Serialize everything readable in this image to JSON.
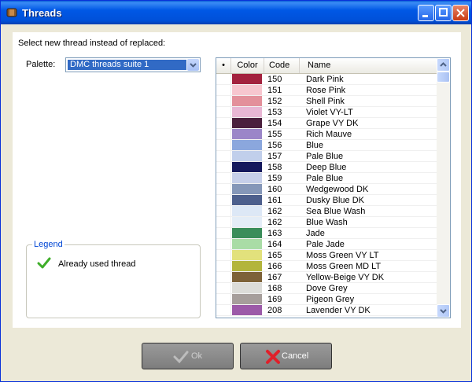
{
  "window": {
    "title": "Threads"
  },
  "prompt": "Select new thread instead of replaced:",
  "palette": {
    "label": "Palette:",
    "value": "DMC threads suite 1"
  },
  "legend": {
    "title": "Legend",
    "items": [
      {
        "label": "Already used thread",
        "icon": "check-icon"
      }
    ]
  },
  "grid": {
    "columns": [
      "•",
      "Color",
      "Code",
      "Name"
    ],
    "rows": [
      {
        "code": "150",
        "name": "Dark Pink",
        "color": "#a3223e"
      },
      {
        "code": "151",
        "name": "Rose Pink",
        "color": "#f7c6cf"
      },
      {
        "code": "152",
        "name": "Shell Pink",
        "color": "#e3909b"
      },
      {
        "code": "153",
        "name": "Violet VY-LT",
        "color": "#e8b6d4"
      },
      {
        "code": "154",
        "name": "Grape VY DK",
        "color": "#4a1f3d"
      },
      {
        "code": "155",
        "name": "Rich Mauve",
        "color": "#9b86c8"
      },
      {
        "code": "156",
        "name": "Blue",
        "color": "#8ba7dd"
      },
      {
        "code": "157",
        "name": "Pale Blue",
        "color": "#c1cfeb"
      },
      {
        "code": "158",
        "name": "Deep Blue",
        "color": "#14185c"
      },
      {
        "code": "159",
        "name": "Pale Blue",
        "color": "#c6cfe9"
      },
      {
        "code": "160",
        "name": "Wedgewood DK",
        "color": "#8597b8"
      },
      {
        "code": "161",
        "name": "Dusky Blue DK",
        "color": "#4d5f8c"
      },
      {
        "code": "162",
        "name": "Sea Blue Wash",
        "color": "#dde8f6"
      },
      {
        "code": "162",
        "name": "Blue Wash",
        "color": "#e4edf7"
      },
      {
        "code": "163",
        "name": "Jade",
        "color": "#3a8d5a"
      },
      {
        "code": "164",
        "name": "Pale Jade",
        "color": "#a9dca6"
      },
      {
        "code": "165",
        "name": "Moss Green VY LT",
        "color": "#e2e17c"
      },
      {
        "code": "166",
        "name": "Moss Green MD LT",
        "color": "#b3b53c"
      },
      {
        "code": "167",
        "name": "Yellow-Beige VY DK",
        "color": "#7d6238"
      },
      {
        "code": "168",
        "name": "Dove Grey",
        "color": "#dcdcd8"
      },
      {
        "code": "169",
        "name": "Pigeon Grey",
        "color": "#a69e9b"
      },
      {
        "code": "208",
        "name": "Lavender VY DK",
        "color": "#9c5aa8"
      }
    ]
  },
  "buttons": {
    "ok": "Ok",
    "cancel": "Cancel"
  }
}
